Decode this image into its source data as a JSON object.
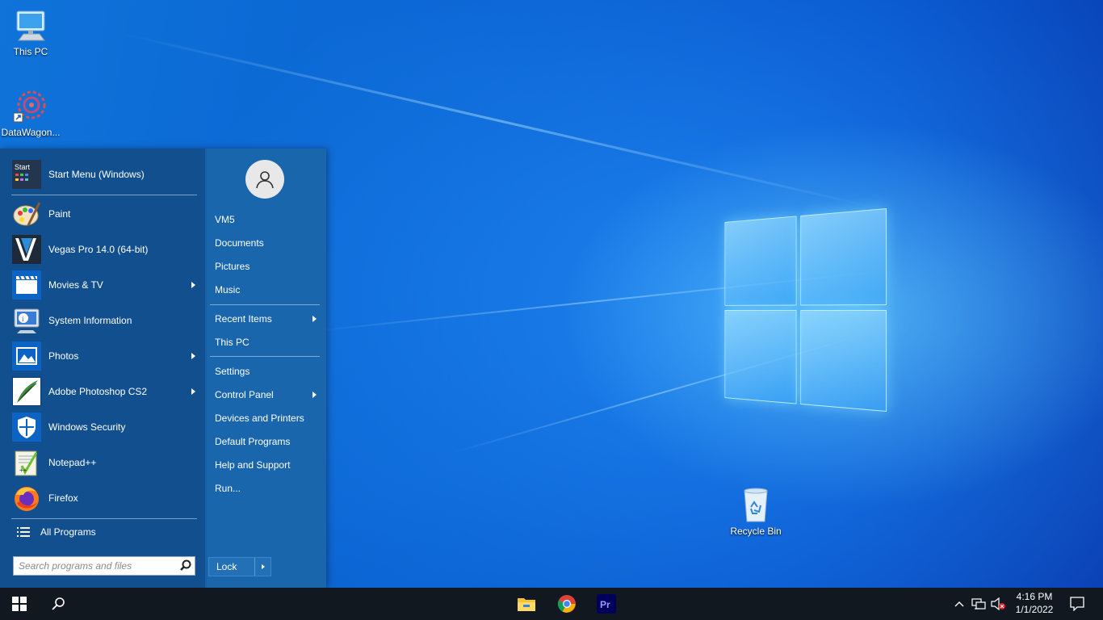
{
  "desktop": {
    "icons": [
      {
        "label": "This PC",
        "icon": "this-pc-icon"
      },
      {
        "label": "DataWagon...",
        "icon": "datawagon-shortcut-icon"
      },
      {
        "label": "Recycle Bin",
        "icon": "recycle-bin-icon"
      }
    ]
  },
  "start_menu": {
    "programs": [
      {
        "label": "Start Menu (Windows)",
        "icon": "start-menu-app-icon",
        "submenu": false
      },
      {
        "label": "Paint",
        "icon": "paint-icon",
        "submenu": false
      },
      {
        "label": "Vegas Pro 14.0 (64-bit)",
        "icon": "vegas-pro-icon",
        "submenu": false
      },
      {
        "label": "Movies & TV",
        "icon": "movies-tv-icon",
        "submenu": true
      },
      {
        "label": "System Information",
        "icon": "system-information-icon",
        "submenu": false
      },
      {
        "label": "Photos",
        "icon": "photos-icon",
        "submenu": true
      },
      {
        "label": "Adobe Photoshop CS2",
        "icon": "photoshop-icon",
        "submenu": true
      },
      {
        "label": "Windows Security",
        "icon": "windows-security-icon",
        "submenu": false
      },
      {
        "label": "Notepad++",
        "icon": "notepad-plus-plus-icon",
        "submenu": false
      },
      {
        "label": "Firefox",
        "icon": "firefox-icon",
        "submenu": false
      }
    ],
    "start_tile_text": "Start",
    "all_programs": "All Programs",
    "search": {
      "placeholder": "Search programs and files"
    },
    "right": {
      "user_items": [
        "VM5",
        "Documents",
        "Pictures",
        "Music"
      ],
      "places": [
        {
          "label": "Recent Items",
          "submenu": true
        },
        {
          "label": "This PC",
          "submenu": false
        }
      ],
      "system": [
        {
          "label": "Settings",
          "submenu": false
        },
        {
          "label": "Control Panel",
          "submenu": true
        },
        {
          "label": "Devices and Printers",
          "submenu": false
        },
        {
          "label": "Default Programs",
          "submenu": false
        },
        {
          "label": "Help and Support",
          "submenu": false
        },
        {
          "label": "Run...",
          "submenu": false
        }
      ],
      "lock": "Lock"
    }
  },
  "taskbar": {
    "pinned": [
      "file-explorer-icon",
      "chrome-icon",
      "premiere-pro-icon"
    ],
    "premiere_label": "Pr",
    "clock": {
      "time": "4:16 PM",
      "date": "1/1/2022"
    }
  },
  "colors": {
    "start_menu_left": "#114f8e",
    "start_menu_right": "#1a66ad",
    "taskbar": "#111820"
  }
}
